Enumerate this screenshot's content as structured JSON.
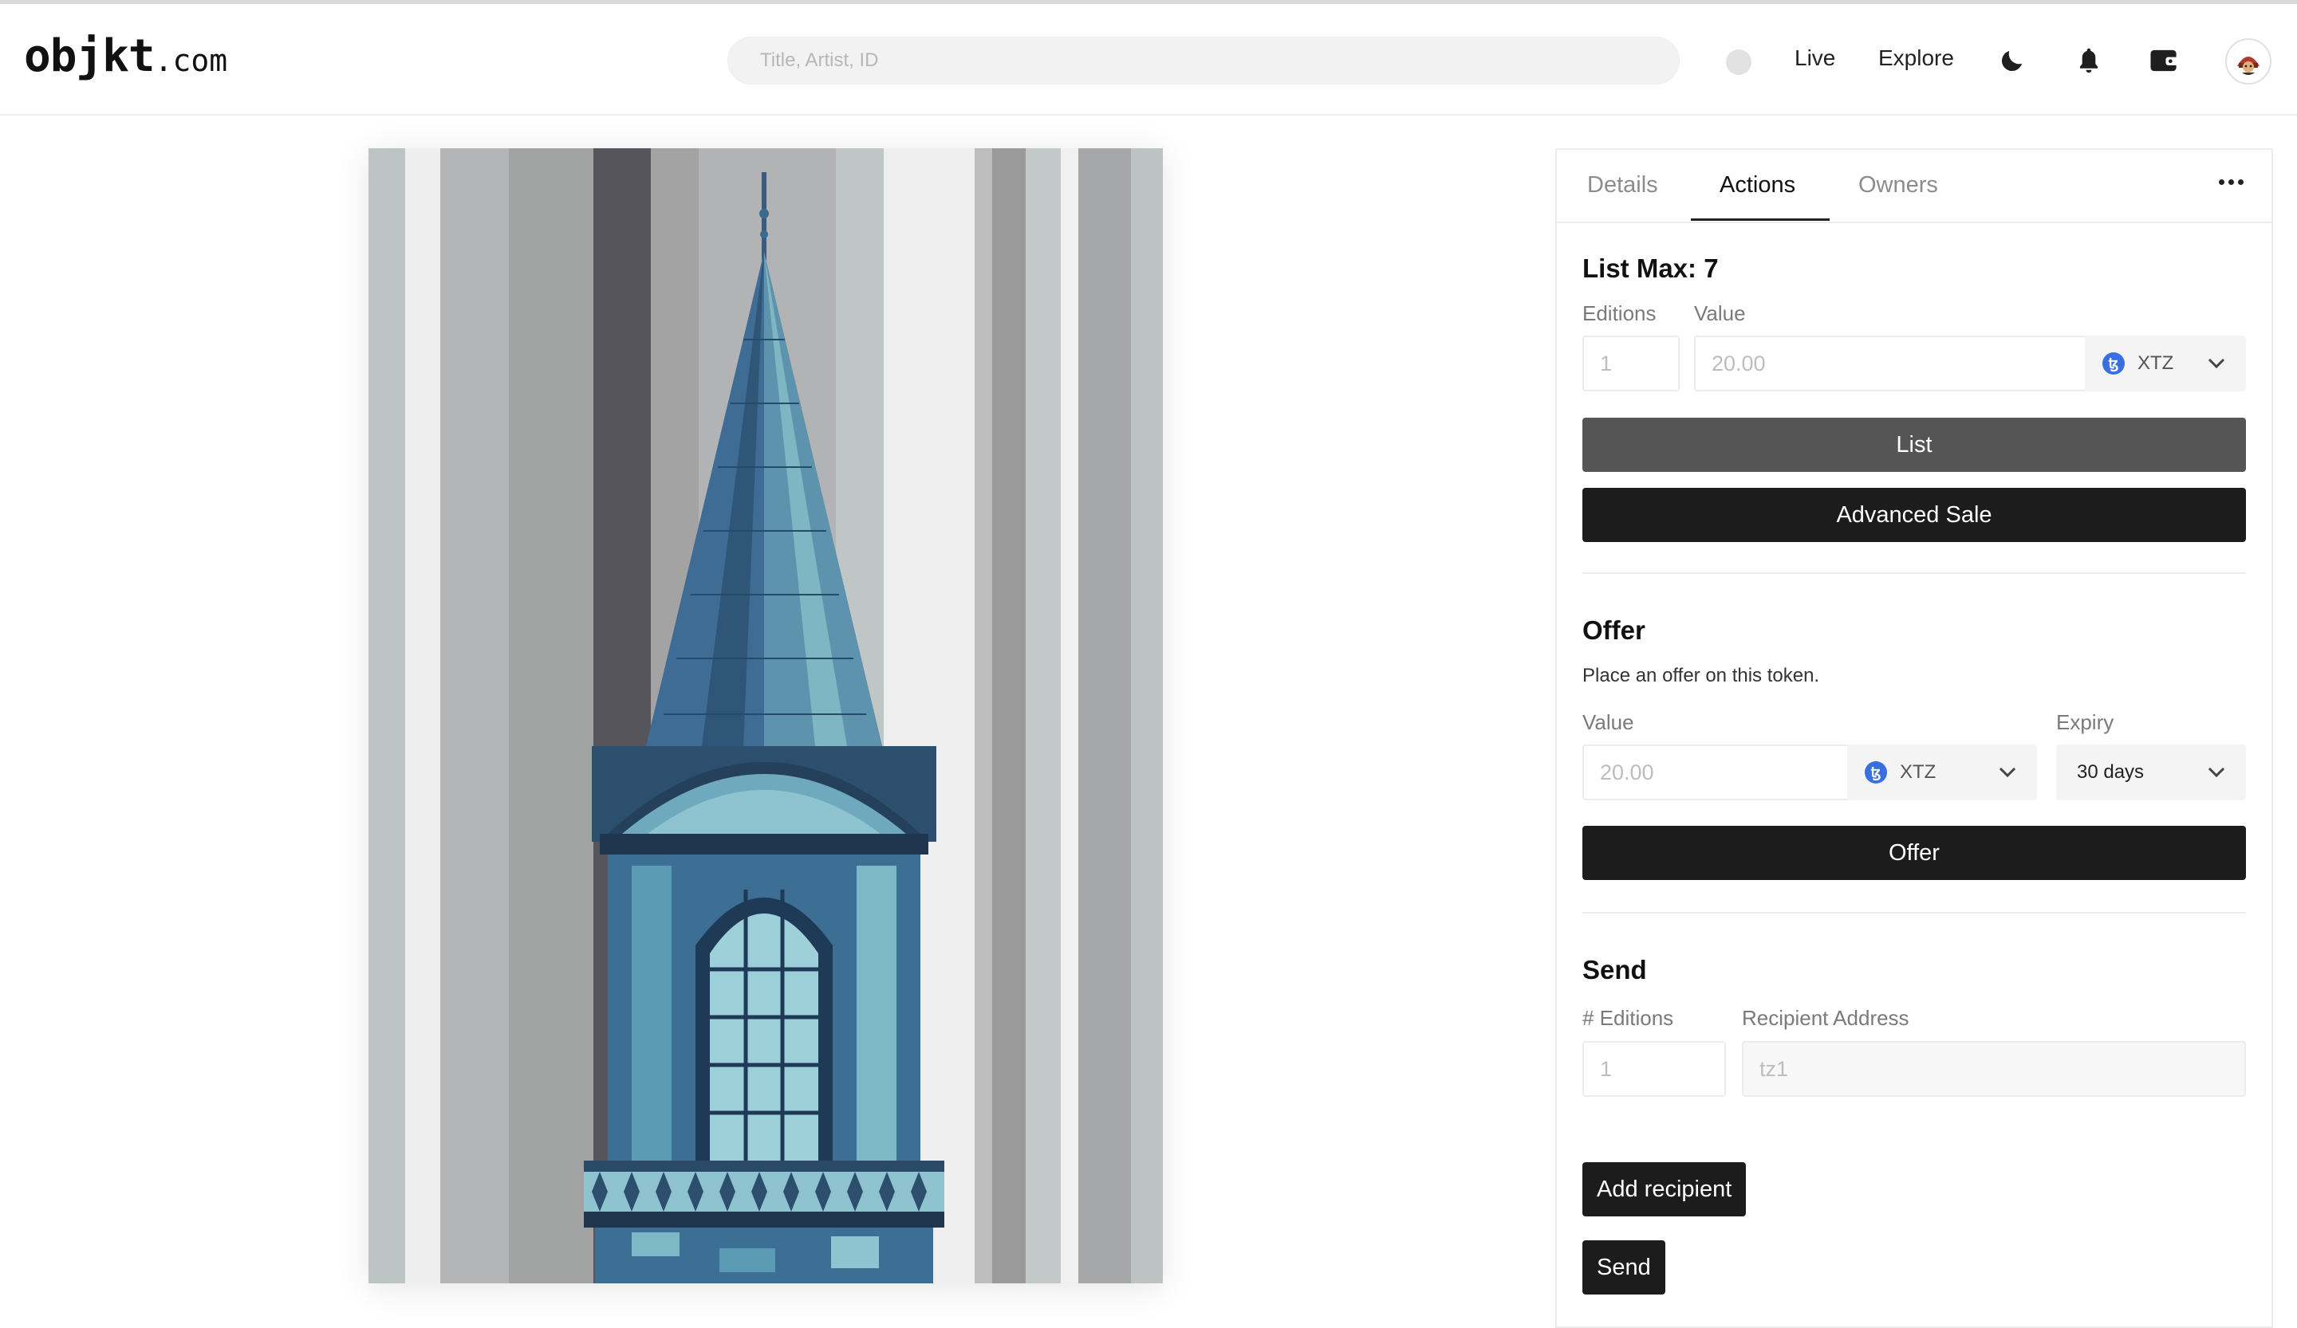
{
  "header": {
    "logo_main": "objkt",
    "logo_tld": ".com",
    "search_placeholder": "Title, Artist, ID",
    "nav": [
      {
        "label": "Live"
      },
      {
        "label": "Explore"
      }
    ],
    "icons": [
      "theme-toggle-icon",
      "bell-icon",
      "wallet-icon",
      "avatar"
    ]
  },
  "tabs": [
    {
      "label": "Details",
      "active": false
    },
    {
      "label": "Actions",
      "active": true
    },
    {
      "label": "Owners",
      "active": false
    }
  ],
  "list": {
    "title": "List Max: 7",
    "editions_label": "Editions",
    "editions_placeholder": "1",
    "value_label": "Value",
    "value_placeholder": "20.00",
    "currency": "XTZ",
    "list_button": "List",
    "advanced_button": "Advanced Sale"
  },
  "offer": {
    "title": "Offer",
    "description": "Place an offer on this token.",
    "value_label": "Value",
    "value_placeholder": "20.00",
    "currency": "XTZ",
    "expiry_label": "Expiry",
    "expiry_value": "30 days",
    "offer_button": "Offer"
  },
  "send": {
    "title": "Send",
    "editions_label": "# Editions",
    "editions_placeholder": "1",
    "recipient_label": "Recipient Address",
    "recipient_placeholder": "tz1",
    "add_recipient_button": "Add recipient",
    "send_button": "Send"
  },
  "colors": {
    "accent_dark": "#1c1c1c",
    "list_button": "#555555",
    "tezos_blue": "#3a6fe0"
  }
}
